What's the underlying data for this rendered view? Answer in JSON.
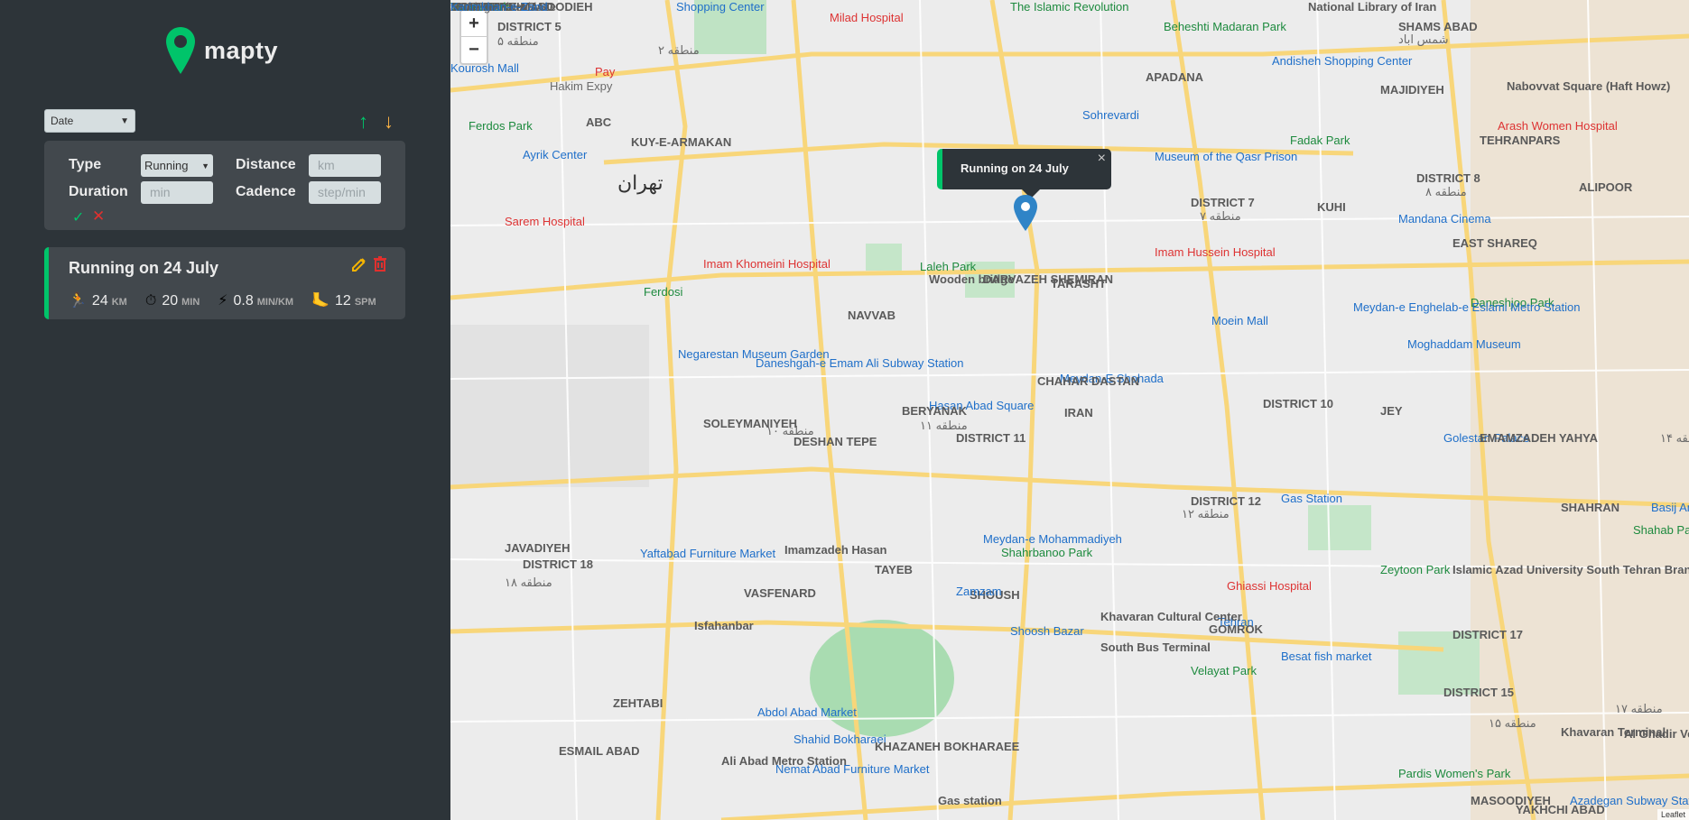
{
  "app": {
    "name": "mapty"
  },
  "sort": {
    "selected": "Date",
    "ascending_glyph": "↑",
    "descending_glyph": "↓"
  },
  "form": {
    "type_label": "Type",
    "type_value": "Running",
    "distance_label": "Distance",
    "distance_placeholder": "km",
    "duration_label": "Duration",
    "duration_placeholder": "min",
    "cadence_label": "Cadence",
    "cadence_placeholder": "step/min",
    "confirm_glyph": "✓",
    "cancel_glyph": "✕"
  },
  "workout": {
    "title": "Running on 24 July",
    "distance": {
      "icon": "🏃",
      "value": "24",
      "unit": "KM"
    },
    "duration": {
      "icon": "⏱",
      "value": "20",
      "unit": "MIN"
    },
    "pace": {
      "icon": "⚡",
      "value": "0.8",
      "unit": "MIN/KM"
    },
    "cadence": {
      "icon": "🦶",
      "value": "12",
      "unit": "SPM"
    }
  },
  "map": {
    "zoom_in": "+",
    "zoom_out": "−",
    "popup_text": "Running on 24 July",
    "popup_close": "×",
    "attribution": "Leaflet",
    "labels": [
      {
        "text": "DISTRICT 5",
        "style": "lbl"
      },
      {
        "text": "منطقه ۵",
        "style": "lbl-fa"
      },
      {
        "text": "Shopping Center",
        "style": "lbl-blue"
      },
      {
        "text": "Milad Hospital",
        "style": "lbl-red"
      },
      {
        "text": "The Islamic Revolution",
        "style": "lbl-green"
      },
      {
        "text": "National Library of Iran",
        "style": "lbl"
      },
      {
        "text": "SHAMS ABAD",
        "style": "lbl"
      },
      {
        "text": "شمس اباد",
        "style": "lbl-fa"
      },
      {
        "text": "Beheshti Madaran Park",
        "style": "lbl-green"
      },
      {
        "text": "Andisheh Shopping Center",
        "style": "lbl-blue"
      },
      {
        "text": "Kourosh Mall",
        "style": "lbl-blue"
      },
      {
        "text": "Pay",
        "style": "lbl-red"
      },
      {
        "text": "منطقه ۲",
        "style": "lbl-fa"
      },
      {
        "text": "Hakim Expy",
        "style": "lbl-fa"
      },
      {
        "text": "Ferdos Park",
        "style": "lbl-green"
      },
      {
        "text": "APADANA",
        "style": "lbl"
      },
      {
        "text": "MAJIDIYEH",
        "style": "lbl"
      },
      {
        "text": "Nabovvat Square (Haft Howz)",
        "style": "lbl"
      },
      {
        "text": "Sohrevardi",
        "style": "lbl-blue"
      },
      {
        "text": "Arash Women Hospital",
        "style": "lbl-red"
      },
      {
        "text": "ABC",
        "style": "lbl"
      },
      {
        "text": "KUY-E-ARMAKAN",
        "style": "lbl"
      },
      {
        "text": "Fadak Park",
        "style": "lbl-green"
      },
      {
        "text": "TEHRANPARS",
        "style": "lbl"
      },
      {
        "text": "Ayrik Center",
        "style": "lbl-blue"
      },
      {
        "text": "تهران",
        "style": "lbl-big"
      },
      {
        "text": "Museum of the Qasr Prison",
        "style": "lbl-blue"
      },
      {
        "text": "DISTRICT 8",
        "style": "lbl"
      },
      {
        "text": "منطقه ۸",
        "style": "lbl-fa"
      },
      {
        "text": "ALIPOOR",
        "style": "lbl"
      },
      {
        "text": "Sarem Hospital",
        "style": "lbl-red"
      },
      {
        "text": "DISTRICT 7",
        "style": "lbl"
      },
      {
        "text": "منطقه ۷",
        "style": "lbl-fa"
      },
      {
        "text": "Mandana Cinema",
        "style": "lbl-blue"
      },
      {
        "text": "Imam Khomeini Hospital",
        "style": "lbl-red"
      },
      {
        "text": "Laleh Park",
        "style": "lbl-green"
      },
      {
        "text": "Imam Hussein Hospital",
        "style": "lbl-red"
      },
      {
        "text": "EAST SHAREQ",
        "style": "lbl"
      },
      {
        "text": "TARASHT",
        "style": "lbl"
      },
      {
        "text": "Daneshjoo Park",
        "style": "lbl-green"
      },
      {
        "text": "Ferdosi",
        "style": "lbl-green"
      },
      {
        "text": "Wooden bridge",
        "style": "lbl"
      },
      {
        "text": "DARVAZEH SHEMIRAN",
        "style": "lbl"
      },
      {
        "text": "Meydan-e Enghelab-e Eslami Metro Station",
        "style": "lbl-blue"
      },
      {
        "text": "Moein Mall",
        "style": "lbl-blue"
      },
      {
        "text": "NAVVAB",
        "style": "lbl"
      },
      {
        "text": "Negarestan Museum Garden",
        "style": "lbl-blue"
      },
      {
        "text": "Moghaddam Museum",
        "style": "lbl-blue"
      },
      {
        "text": "Meydan-E Shohada",
        "style": "lbl-blue"
      },
      {
        "text": "CHAHAR DASTAN",
        "style": "lbl"
      },
      {
        "text": "JEY",
        "style": "lbl"
      },
      {
        "text": "Daneshgah-e Emam Ali Subway Station",
        "style": "lbl-blue"
      },
      {
        "text": "Hasan Abad Square",
        "style": "lbl-blue"
      },
      {
        "text": "IRAN",
        "style": "lbl"
      },
      {
        "text": "DISTRICT 10",
        "style": "lbl"
      },
      {
        "text": "منطقه ۱۰",
        "style": "lbl-fa"
      },
      {
        "text": "SOLEYMANIYEH",
        "style": "lbl"
      },
      {
        "text": "DESHAN TEPE",
        "style": "lbl"
      },
      {
        "text": "Golestan Palace",
        "style": "lbl-blue"
      },
      {
        "text": "EMAMZADEH YAHYA",
        "style": "lbl"
      },
      {
        "text": "DISTRICT 11",
        "style": "lbl"
      },
      {
        "text": "منطقه ۱۱",
        "style": "lbl-fa"
      },
      {
        "text": "BERYANAK",
        "style": "lbl"
      },
      {
        "text": "منطقه ۱۴",
        "style": "lbl-fa"
      },
      {
        "text": "DISTRICT 12",
        "style": "lbl"
      },
      {
        "text": "منطقه ۱۲",
        "style": "lbl-fa"
      },
      {
        "text": "Gas Station",
        "style": "lbl-blue"
      },
      {
        "text": "SHAHRAN",
        "style": "lbl"
      },
      {
        "text": "Basij Amusement Park",
        "style": "lbl-blue"
      },
      {
        "text": "Shahab Park",
        "style": "lbl-green"
      },
      {
        "text": "Meydan-e Mohammadiyeh",
        "style": "lbl-blue"
      },
      {
        "text": "Yaftabad Furniture Market",
        "style": "lbl-blue"
      },
      {
        "text": "Imamzadeh Hasan",
        "style": "lbl"
      },
      {
        "text": "GOMROK",
        "style": "lbl"
      },
      {
        "text": "Zeytoon Park",
        "style": "lbl-green"
      },
      {
        "text": "Islamic Azad University South Tehran Branch",
        "style": "lbl"
      },
      {
        "text": "Ghiassi Hospital",
        "style": "lbl-red"
      },
      {
        "text": "Shahrbanoo Park",
        "style": "lbl-green"
      },
      {
        "text": "Tehran",
        "style": "lbl-blue"
      },
      {
        "text": "Shoosh Bazar",
        "style": "lbl-blue"
      },
      {
        "text": "SHOUSH",
        "style": "lbl"
      },
      {
        "text": "TAYEB",
        "style": "lbl"
      },
      {
        "text": "Khavaran Cultural Center",
        "style": "lbl"
      },
      {
        "text": "DISTRICT 17",
        "style": "lbl"
      },
      {
        "text": "منطقه ۱۷",
        "style": "lbl-fa"
      },
      {
        "text": "JAVADIYEH",
        "style": "lbl"
      },
      {
        "text": "DISTRICT 18",
        "style": "lbl"
      },
      {
        "text": "منطقه ۱۸",
        "style": "lbl-fa"
      },
      {
        "text": "Zamzam",
        "style": "lbl-blue"
      },
      {
        "text": "South Bus Terminal",
        "style": "lbl"
      },
      {
        "text": "VASFENARD",
        "style": "lbl"
      },
      {
        "text": "Isfahanbar",
        "style": "lbl"
      },
      {
        "text": "Besat fish market",
        "style": "lbl-blue"
      },
      {
        "text": "Velayat Park",
        "style": "lbl-green"
      },
      {
        "text": "DISTRICT 15",
        "style": "lbl"
      },
      {
        "text": "منطقه ۱۵",
        "style": "lbl-fa"
      },
      {
        "text": "Khavaran Terminal",
        "style": "lbl"
      },
      {
        "text": "Al Ghadir Vehicle Licensing Office",
        "style": "lbl"
      },
      {
        "text": "ZEHTABI",
        "style": "lbl"
      },
      {
        "text": "Shahid Bokharaei",
        "style": "lbl-blue"
      },
      {
        "text": "KHAZANEH BOKHARAEE",
        "style": "lbl"
      },
      {
        "text": "Abdol Abad Market",
        "style": "lbl-blue"
      },
      {
        "text": "Ali Abad Metro Station",
        "style": "lbl"
      },
      {
        "text": "ESMAIL ABAD",
        "style": "lbl"
      },
      {
        "text": "Nemat Abad Furniture Market",
        "style": "lbl-blue"
      },
      {
        "text": "Gas station",
        "style": "lbl"
      },
      {
        "text": "Pardis Women's Park",
        "style": "lbl-green"
      },
      {
        "text": "MASOODIYEH",
        "style": "lbl"
      },
      {
        "text": "Azadegan Subway Station",
        "style": "lbl-blue"
      },
      {
        "text": "YAKHCHI ABAD",
        "style": "lbl"
      },
      {
        "text": "KUHI",
        "style": "lbl"
      },
      {
        "text": "SOUTHERN ABAD",
        "style": "lbl"
      },
      {
        "text": "Azadegan local lane",
        "style": "lbl-fa"
      },
      {
        "text": "Toosa Park",
        "style": "lbl-green"
      },
      {
        "text": "MOSHIRIYEH",
        "style": "lbl"
      },
      {
        "text": "SHAHRAKE MASOODIEH",
        "style": "lbl"
      },
      {
        "text": "Karimkhan-e-Zand",
        "style": "lbl-blue"
      }
    ]
  }
}
